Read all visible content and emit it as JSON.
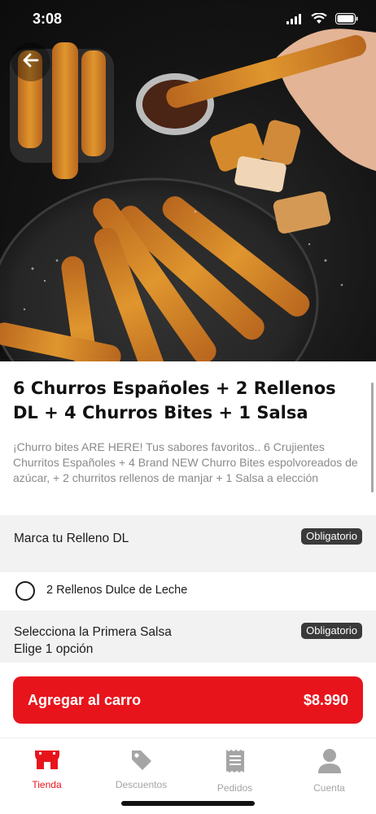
{
  "status_bar": {
    "time": "3:08"
  },
  "product": {
    "title": "6 Churros Españoles + 2 Rellenos DL + 4 Churros Bites + 1 Salsa",
    "description": "¡Churro bites ARE HERE! Tus sabores favoritos.. 6 Crujientes Churritos Españoles + 4 Brand NEW Churro Bites espolvoreados de azúcar, + 2 churritos rellenos de manjar + 1 Salsa a elección"
  },
  "sections": [
    {
      "title": "Marca tu Relleno DL",
      "badge": "Obligatorio"
    },
    {
      "title": "Selecciona la Primera Salsa",
      "subtitle": "Elige 1 opción",
      "badge": "Obligatorio"
    }
  ],
  "options": [
    {
      "label": "2 Rellenos Dulce de Leche",
      "selected": false
    }
  ],
  "cart_button": {
    "label": "Agregar al carro",
    "price": "$8.990"
  },
  "tabbar": {
    "active_color": "#e8141c",
    "inactive_color": "#a5a5a5",
    "items": [
      {
        "label": "Tienda",
        "icon": "store-icon",
        "active": true
      },
      {
        "label": "Descuentos",
        "icon": "tag-icon",
        "active": false
      },
      {
        "label": "Pedidos",
        "icon": "receipt-icon",
        "active": false
      },
      {
        "label": "Cuenta",
        "icon": "user-icon",
        "active": false
      }
    ]
  },
  "colors": {
    "accent": "#e8141c",
    "badge_bg": "#3a3a3a",
    "section_bg": "#f2f2f2"
  }
}
